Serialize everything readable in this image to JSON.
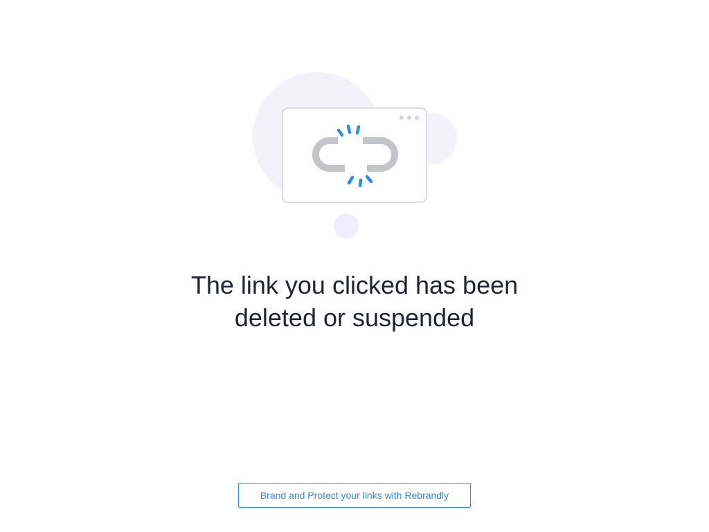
{
  "message": {
    "line1": "The link you clicked has been",
    "line2": "deleted or suspended"
  },
  "illustration": {
    "icon": "broken-link-icon",
    "accent_color": "#2b8de6",
    "bubble_color": "#f3f2fb",
    "link_color": "#c3c5c9"
  },
  "footer": {
    "cta_label": "Brand and Protect your links with Rebrandly"
  }
}
